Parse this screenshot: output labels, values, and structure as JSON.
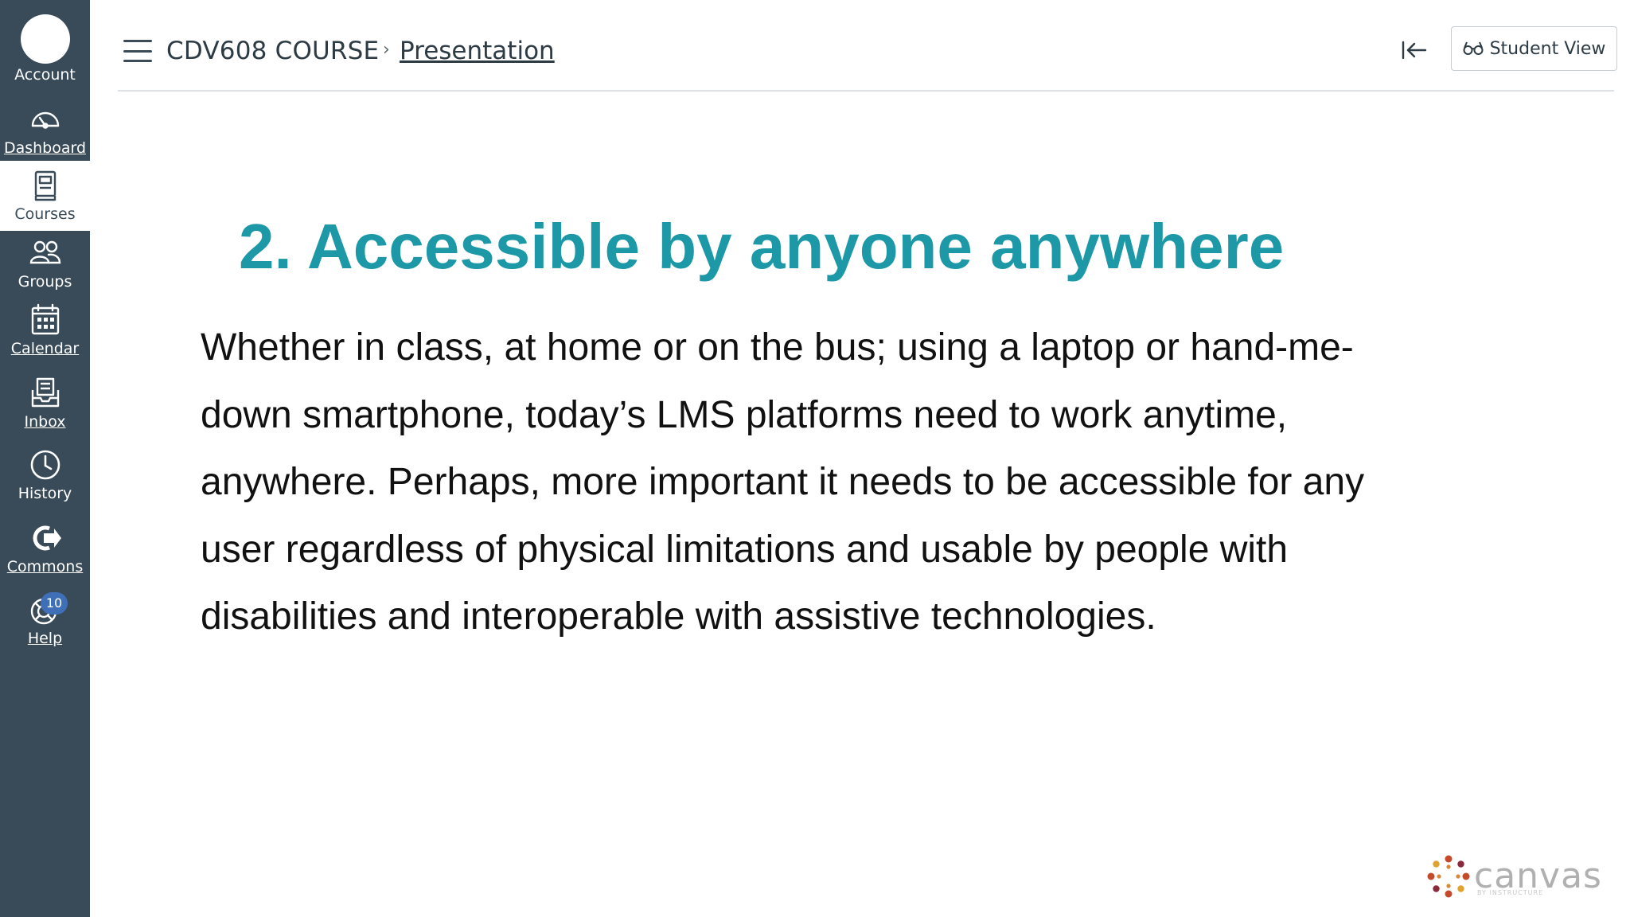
{
  "nav": {
    "account": "Account",
    "dashboard": "Dashboard",
    "courses": "Courses",
    "groups": "Groups",
    "calendar": "Calendar",
    "inbox": "Inbox",
    "history": "History",
    "commons": "Commons",
    "help": "Help",
    "help_badge": "10"
  },
  "header": {
    "course": "CDV608 COURSE",
    "separator": "›",
    "page": "Presentation",
    "student_view": "Student View"
  },
  "slide": {
    "title": "2. Accessible by anyone anywhere",
    "body_lines": [
      "Whether in class, at home or on the bus; using a laptop or hand-me-",
      "down smartphone, today’s LMS platforms need to work anytime,",
      "anywhere. Perhaps, more important it needs to be accessible for any",
      "user regardless of physical limitations and usable by people with",
      "disabilities and interoperable with assistive technologies."
    ]
  },
  "logo": {
    "word": "canvas",
    "sub": "BY INSTRUCTURE"
  },
  "colors": {
    "rail": "#394b58",
    "title": "#1c98a6",
    "badge": "#3f6fb7"
  },
  "icons": {
    "dashboard": "speedometer-icon",
    "courses": "book-icon",
    "groups": "people-icon",
    "calendar": "calendar-icon",
    "inbox": "inbox-icon",
    "history": "clock-icon",
    "commons": "commons-arrow-icon",
    "help": "lifebuoy-icon",
    "collapse": "collapse-left-icon",
    "student_view": "glasses-icon"
  }
}
